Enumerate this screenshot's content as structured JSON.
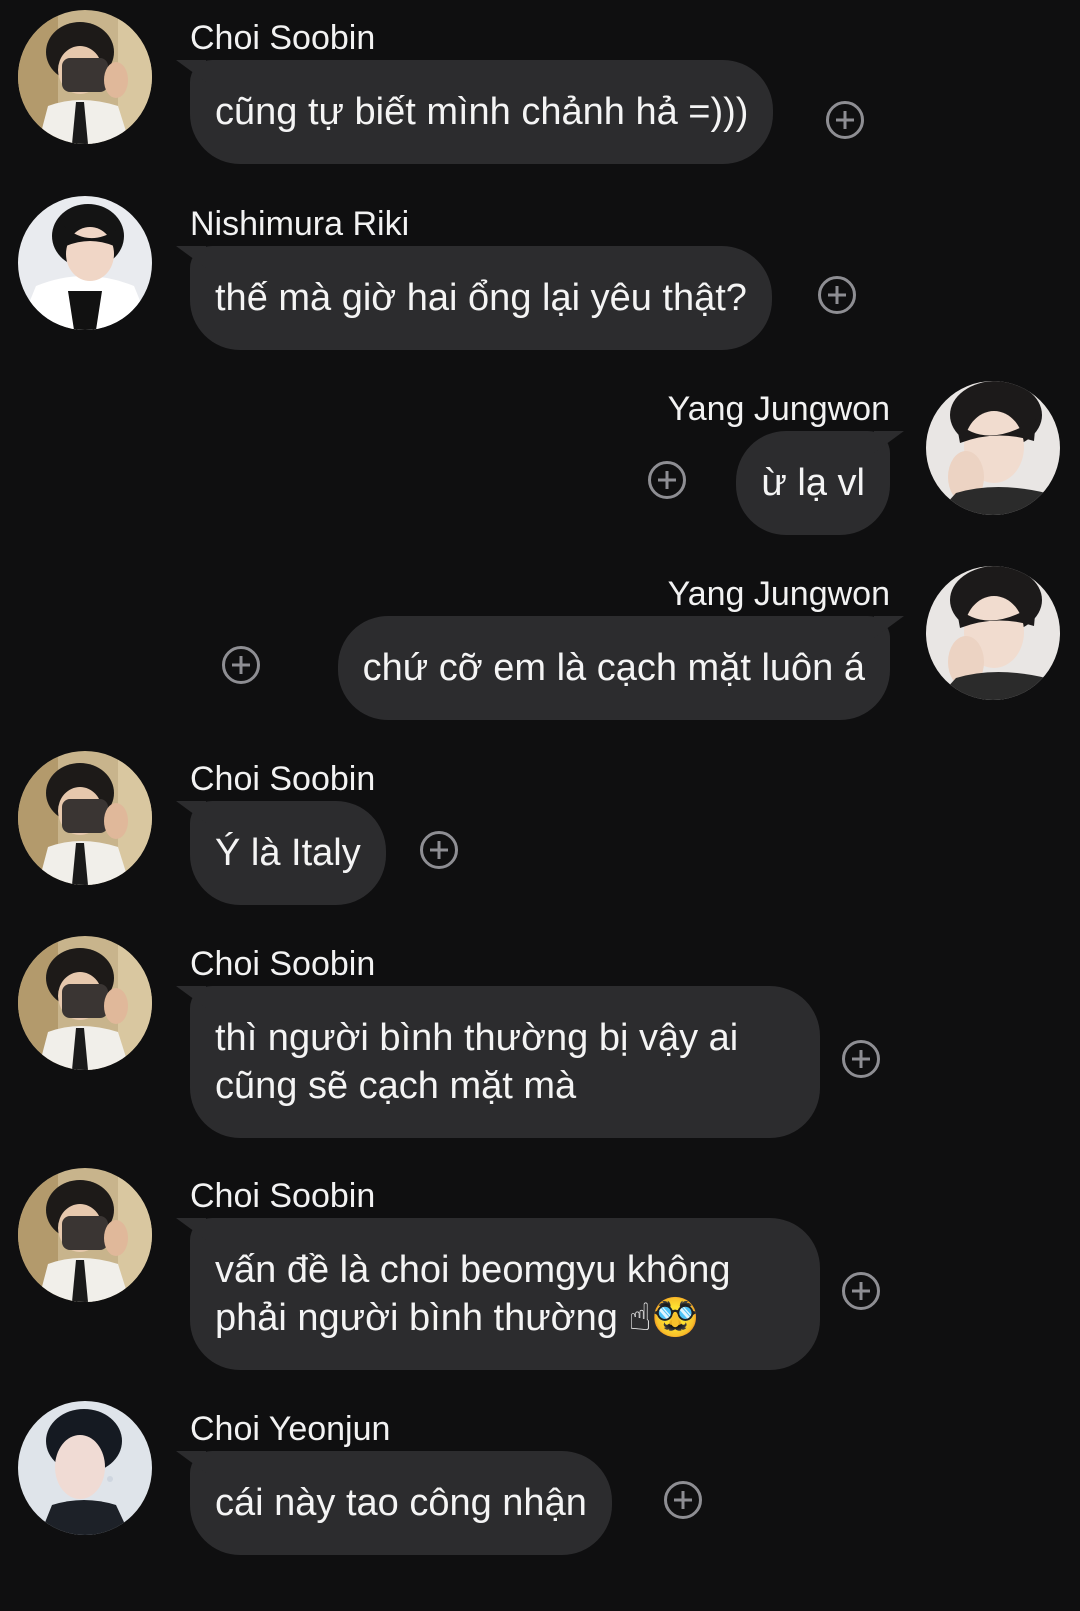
{
  "messages": [
    {
      "sender": "Choi Soobin",
      "text": "cũng tự biết mình chảnh hả =)))",
      "avatar": "soobin-avatar"
    },
    {
      "sender": "Nishimura Riki",
      "text": "thế mà giờ hai ổng lại yêu thật?",
      "avatar": "riki-avatar"
    },
    {
      "sender": "Yang Jungwon",
      "text": "ừ lạ vl",
      "avatar": "jungwon-avatar"
    },
    {
      "sender": "Yang Jungwon",
      "text": "chứ cỡ em là cạch mặt luôn á",
      "avatar": "jungwon-avatar"
    },
    {
      "sender": "Choi Soobin",
      "text": "Ý là Italy",
      "avatar": "soobin-avatar"
    },
    {
      "sender": "Choi Soobin",
      "text": "thì người bình thường bị vậy ai\ncũng sẽ cạch mặt mà",
      "avatar": "soobin-avatar"
    },
    {
      "sender": "Choi Soobin",
      "text": "vấn đề là choi beomgyu không\nphải người bình thường ☝🥸",
      "avatar": "soobin-avatar"
    },
    {
      "sender": "Choi Yeonjun",
      "text": "cái này tao công nhận",
      "avatar": "yeonjun-avatar"
    }
  ],
  "colors": {
    "background": "#0f0f10",
    "bubble": "#2c2c2e",
    "icon": "#8e8e93"
  },
  "icons": {
    "reaction": "add-reaction-icon"
  }
}
